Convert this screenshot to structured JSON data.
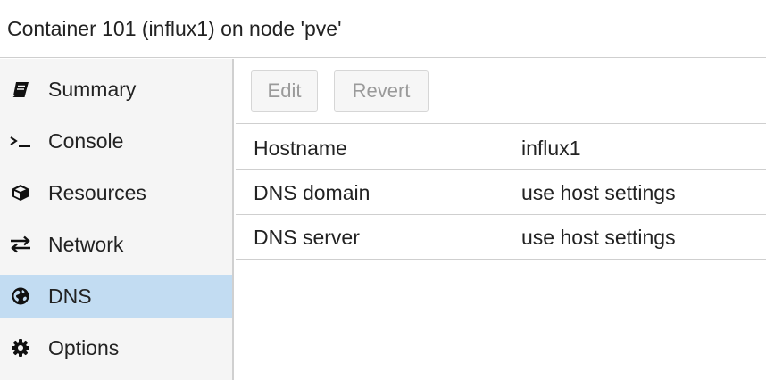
{
  "window": {
    "title": "Container 101 (influx1) on node 'pve'"
  },
  "sidebar": {
    "items": [
      {
        "label": "Summary",
        "icon": "book-icon",
        "selected": false
      },
      {
        "label": "Console",
        "icon": "terminal-icon",
        "selected": false
      },
      {
        "label": "Resources",
        "icon": "cube-icon",
        "selected": false
      },
      {
        "label": "Network",
        "icon": "exchange-icon",
        "selected": false
      },
      {
        "label": "DNS",
        "icon": "globe-icon",
        "selected": true
      },
      {
        "label": "Options",
        "icon": "gear-icon",
        "selected": false
      }
    ]
  },
  "toolbar": {
    "edit_label": "Edit",
    "revert_label": "Revert"
  },
  "dns_grid": {
    "rows": [
      {
        "key": "Hostname",
        "value": "influx1"
      },
      {
        "key": "DNS domain",
        "value": "use host settings"
      },
      {
        "key": "DNS server",
        "value": "use host settings"
      }
    ]
  },
  "colors": {
    "selected_bg": "#c2dcf2",
    "sidebar_bg": "#f5f5f5",
    "border": "#cfcfcf",
    "disabled_text": "#9a9a9a"
  }
}
